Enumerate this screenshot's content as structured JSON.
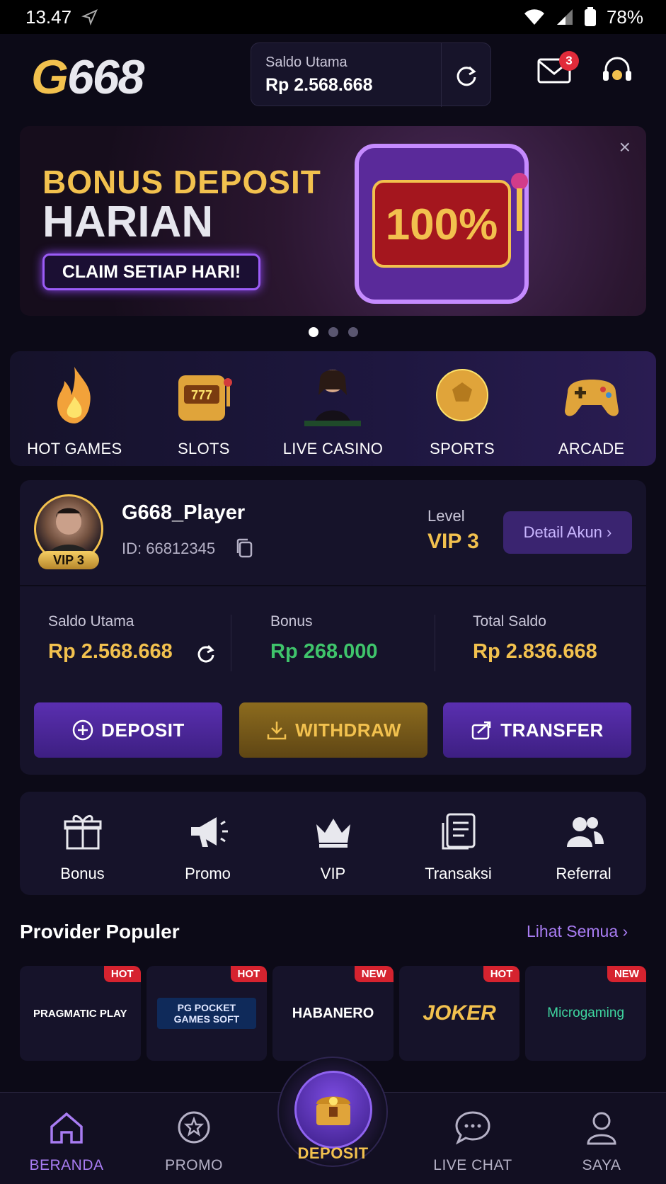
{
  "status_bar": {
    "time": "13.47",
    "battery": "78%"
  },
  "header": {
    "logo_g": "G",
    "logo_rest": "668",
    "balance_label": "Saldo Utama",
    "balance_value": "Rp 2.568.668",
    "mail_count": "3"
  },
  "banner": {
    "line1": "BONUS DEPOSIT",
    "line2": "HARIAN",
    "claim": "CLAIM SETIAP HARI!",
    "percent": "100%"
  },
  "categories": [
    {
      "label": "HOT GAMES",
      "icon": "fire-icon"
    },
    {
      "label": "SLOTS",
      "icon": "slot-machine-icon"
    },
    {
      "label": "LIVE CASINO",
      "icon": "dealer-icon"
    },
    {
      "label": "SPORTS",
      "icon": "ball-icon"
    },
    {
      "label": "ARCADE",
      "icon": "gamepad-icon"
    }
  ],
  "account": {
    "vip_tag": "VIP 3",
    "username": "G668_Player",
    "id": "ID: 66812345",
    "level_label": "Level",
    "level_value": "VIP 3",
    "detail_button": "Detail Akun",
    "main_label": "Saldo Utama",
    "main_value": "Rp 2.568.668",
    "bonus_label": "Bonus",
    "bonus_value": "Rp 268.000",
    "total_label": "Total Saldo",
    "total_value": "Rp 2.836.668",
    "deposit_button": "DEPOSIT",
    "withdraw_button": "WITHDRAW",
    "transfer_button": "TRANSFER"
  },
  "quick_menu": [
    {
      "label": "Bonus",
      "icon": "gift-icon"
    },
    {
      "label": "Promo",
      "icon": "megaphone-icon"
    },
    {
      "label": "VIP",
      "icon": "crown-icon"
    },
    {
      "label": "Transaksi",
      "icon": "receipt-icon"
    },
    {
      "label": "Referral",
      "icon": "users-icon"
    }
  ],
  "providers": {
    "title": "Provider Populer",
    "see_all": "Lihat Semua",
    "items": [
      {
        "name": "PRAGMATIC PLAY",
        "tag": "HOT"
      },
      {
        "name": "PG POCKET GAMES SOFT",
        "tag": "HOT"
      },
      {
        "name": "HABANERO",
        "tag": "NEW"
      },
      {
        "name": "JOKER",
        "tag": "HOT"
      },
      {
        "name": "Microgaming",
        "tag": "NEW"
      }
    ]
  },
  "bottom_nav": {
    "home": "BERANDA",
    "promo": "PROMO",
    "deposit": "DEPOSIT",
    "live_chat": "LIVE CHAT",
    "profile": "SAYA"
  },
  "colors": {
    "accent": "#a87cf2",
    "gold": "#f2c14e",
    "green": "#3fc46b",
    "badge": "#e12b3a"
  }
}
